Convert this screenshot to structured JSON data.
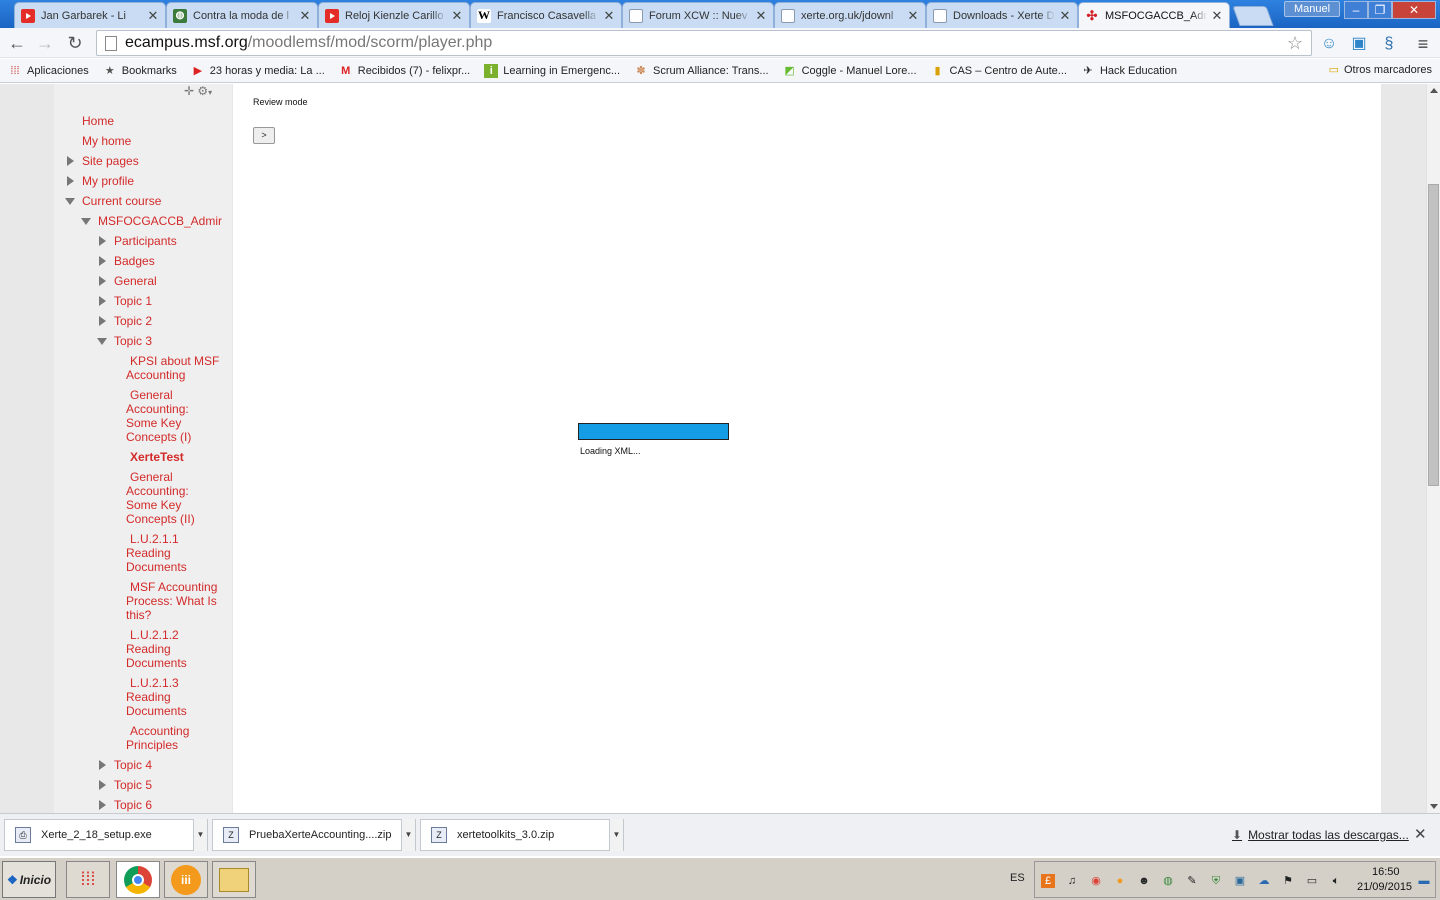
{
  "tabs": [
    {
      "title": "Jan Garbarek - Li",
      "icon": "youtube-icon"
    },
    {
      "title": "Contra la moda de l",
      "icon": "site-icon"
    },
    {
      "title": "Reloj Kienzle Carillo",
      "icon": "youtube-icon"
    },
    {
      "title": "Francisco Casavella",
      "icon": "wikipedia-icon"
    },
    {
      "title": "Forum XCW :: Nuev",
      "icon": "page-icon"
    },
    {
      "title": "xerte.org.uk/jdownl",
      "icon": "page-icon"
    },
    {
      "title": "Downloads - Xerte D",
      "icon": "page-icon"
    },
    {
      "title": "MSFOCGACCB_Admi",
      "icon": "msf-icon"
    }
  ],
  "window": {
    "user": "Manuel"
  },
  "omnibox": {
    "host": "ecampus.msf.org",
    "path": "/moodlemsf/mod/scorm/player.php"
  },
  "bookmarks": {
    "items": [
      {
        "label": "Aplicaciones"
      },
      {
        "label": "Bookmarks"
      },
      {
        "label": "23 horas y media: La ..."
      },
      {
        "label": "Recibidos (7) - felixpr..."
      },
      {
        "label": "Learning in Emergenc..."
      },
      {
        "label": "Scrum Alliance: Trans..."
      },
      {
        "label": "Coggle - Manuel Lore..."
      },
      {
        "label": "CAS – Centro de Aute..."
      },
      {
        "label": "Hack Education"
      }
    ],
    "other": "Otros marcadores"
  },
  "sidebar": {
    "items": [
      {
        "label": "Home"
      },
      {
        "label": "My home"
      },
      {
        "label": "Site pages"
      },
      {
        "label": "My profile"
      },
      {
        "label": "Current course"
      },
      {
        "label": "MSFOCGACCB_Admir"
      },
      {
        "label": "Participants"
      },
      {
        "label": "Badges"
      },
      {
        "label": "General"
      },
      {
        "label": "Topic 1"
      },
      {
        "label": "Topic 2"
      },
      {
        "label": "Topic 3"
      },
      {
        "label": "KPSI about MSF Accounting"
      },
      {
        "label": "General Accounting: Some Key Concepts (I)"
      },
      {
        "label": "XerteTest"
      },
      {
        "label": "General Accounting: Some Key Concepts (II)"
      },
      {
        "label": "L.U.2.1.1 Reading Documents"
      },
      {
        "label": "MSF Accounting Process: What Is this?"
      },
      {
        "label": "L.U.2.1.2 Reading Documents"
      },
      {
        "label": "L.U.2.1.3 Reading Documents"
      },
      {
        "label": "Accounting Principles"
      },
      {
        "label": "Topic 4"
      },
      {
        "label": "Topic 5"
      },
      {
        "label": "Topic 6"
      }
    ]
  },
  "content": {
    "review_mode": "Review mode",
    "next_button": ">",
    "loading_text": "Loading XML...",
    "progress": 1.0,
    "progress_color": "#149ce4"
  },
  "downloads": {
    "items": [
      {
        "name": "Xerte_2_18_setup.exe"
      },
      {
        "name": "PruebaXerteAccounting....zip"
      },
      {
        "name": "xertetoolkits_3.0.zip"
      }
    ],
    "show_all": "Mostrar todas las descargas..."
  },
  "taskbar": {
    "start": "Inicio",
    "lang": "ES",
    "time": "16:50",
    "date": "21/09/2015"
  },
  "colors": {
    "link": "#d32a2a",
    "accent": "#1a64c4"
  }
}
